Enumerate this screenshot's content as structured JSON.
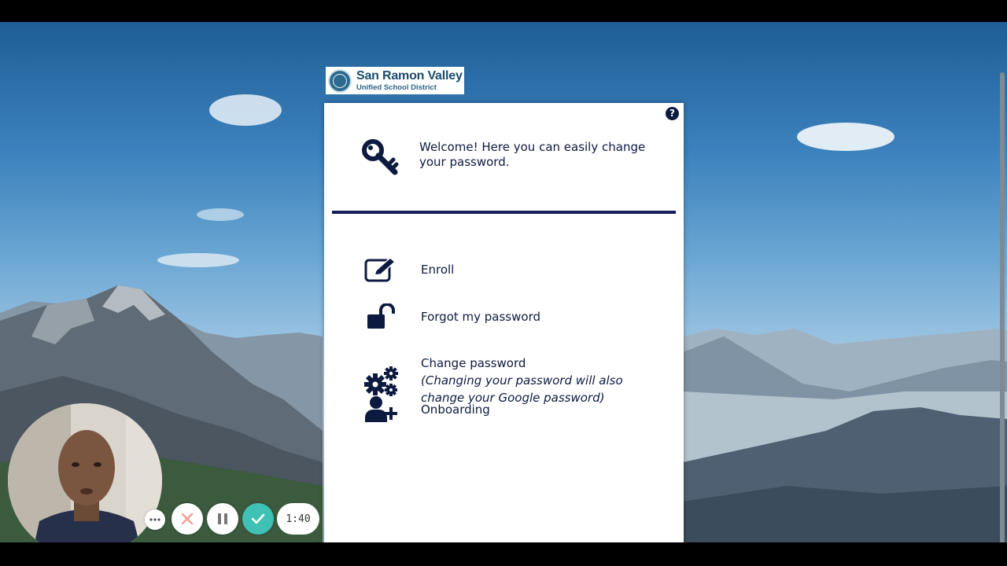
{
  "logo": {
    "name": "San Ramon Valley",
    "subtitle": "Unified School District"
  },
  "panel": {
    "help_icon": "question-icon",
    "welcome_text": "Welcome! Here you can easily change your password.",
    "menu": [
      {
        "label": "Enroll",
        "icon": "edit-icon"
      },
      {
        "label": "Forgot my password",
        "icon": "unlock-icon"
      },
      {
        "label": "Change password",
        "note": "(Changing your password will also change your Google password)",
        "icon": "gears-icon"
      },
      {
        "label": "Onboarding",
        "icon": "add-user-icon"
      }
    ]
  },
  "recorder": {
    "timer": "1:40",
    "more_icon": "more-icon",
    "cancel_icon": "close-icon",
    "pause_icon": "pause-icon",
    "done_icon": "check-icon"
  },
  "colors": {
    "navy": "#0d1a40",
    "divider": "#141c5a",
    "accent_teal": "#3fc1b5",
    "cancel_red": "#f0a090"
  }
}
